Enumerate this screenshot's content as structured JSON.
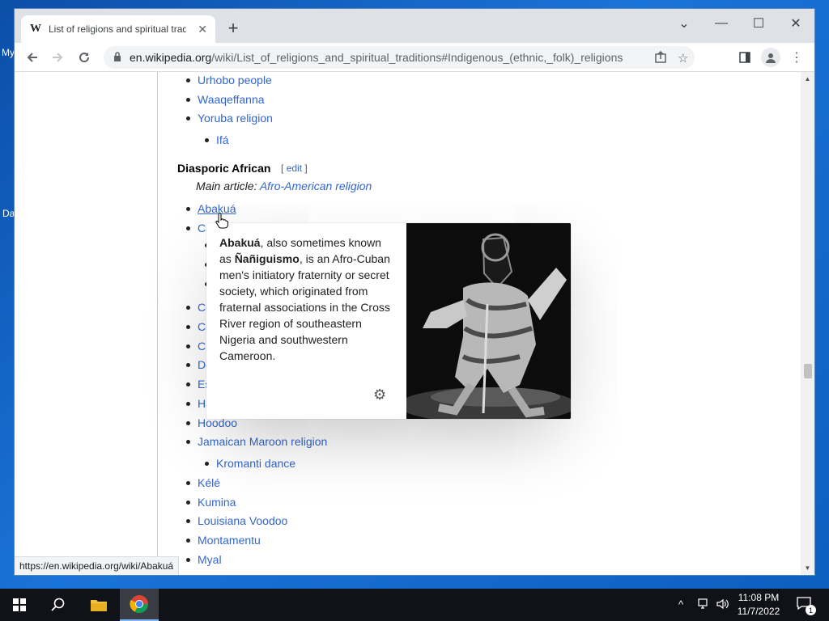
{
  "desktop": {
    "fragments": [
      "My",
      "Da"
    ]
  },
  "browser": {
    "tab": {
      "favicon": "W",
      "title": "List of religions and spiritual tradi",
      "close_icon": "close-icon"
    },
    "new_tab": "+",
    "window_controls": {
      "dropdown": "⌄",
      "minimize": "—",
      "maximize": "☐",
      "close": "✕"
    },
    "address": {
      "host": "en.wikipedia.org",
      "path": "/wiki/List_of_religions_and_spiritual_traditions#Indigenous_(ethnic,_folk)_religions"
    }
  },
  "page": {
    "list_top": [
      {
        "text": "Urhobo people",
        "level": 1
      },
      {
        "text": "Waaqeffanna",
        "level": 1
      },
      {
        "text": "Yoruba religion",
        "level": 1
      },
      {
        "text": "Ifá",
        "level": 2
      }
    ],
    "section": {
      "heading": "Diasporic African",
      "edit_open": "[",
      "edit_label": "edit",
      "edit_close": "]",
      "hatnote_prefix": "Main article: ",
      "hatnote_link": "Afro-American religion"
    },
    "list_visible": [
      {
        "text": "Abakuá",
        "level": 1
      },
      {
        "text": "Ca",
        "level": 1
      },
      {
        "text": "Co",
        "level": 1
      },
      {
        "text": "Co",
        "level": 1
      },
      {
        "text": "Cu",
        "level": 1
      },
      {
        "text": "Do",
        "level": 1
      },
      {
        "text": "Es",
        "level": 1
      },
      {
        "text": "Ha",
        "level": 1
      },
      {
        "text": "Hoodoo",
        "level": 1
      },
      {
        "text": "Jamaican Maroon religion",
        "level": 1
      },
      {
        "text": "Kromanti dance",
        "level": 2
      },
      {
        "text": "Kélé",
        "level": 1
      },
      {
        "text": "Kumina",
        "level": 1
      },
      {
        "text": "Louisiana Voodoo",
        "level": 1
      },
      {
        "text": "Montamentu",
        "level": 1
      },
      {
        "text": "Myal",
        "level": 1
      }
    ]
  },
  "popup": {
    "bold1": "Abakuá",
    "text1": ", also sometimes known as ",
    "bold2": "Ñañiguismo",
    "text2": ", is an Afro-Cuban men's initiatory fraternity or secret society, which originated from fraternal associations in the Cross River region of southeastern Nigeria and southwestern Cameroon.",
    "settings_icon": "gear-icon"
  },
  "status_url": "https://en.wikipedia.org/wiki/Abakuá",
  "taskbar": {
    "time": "11:08 PM",
    "date": "11/7/2022",
    "notification_count": "1"
  },
  "colors": {
    "link": "#3366cc",
    "taskbar": "#101217",
    "chrome_frame": "#dee1e6"
  }
}
